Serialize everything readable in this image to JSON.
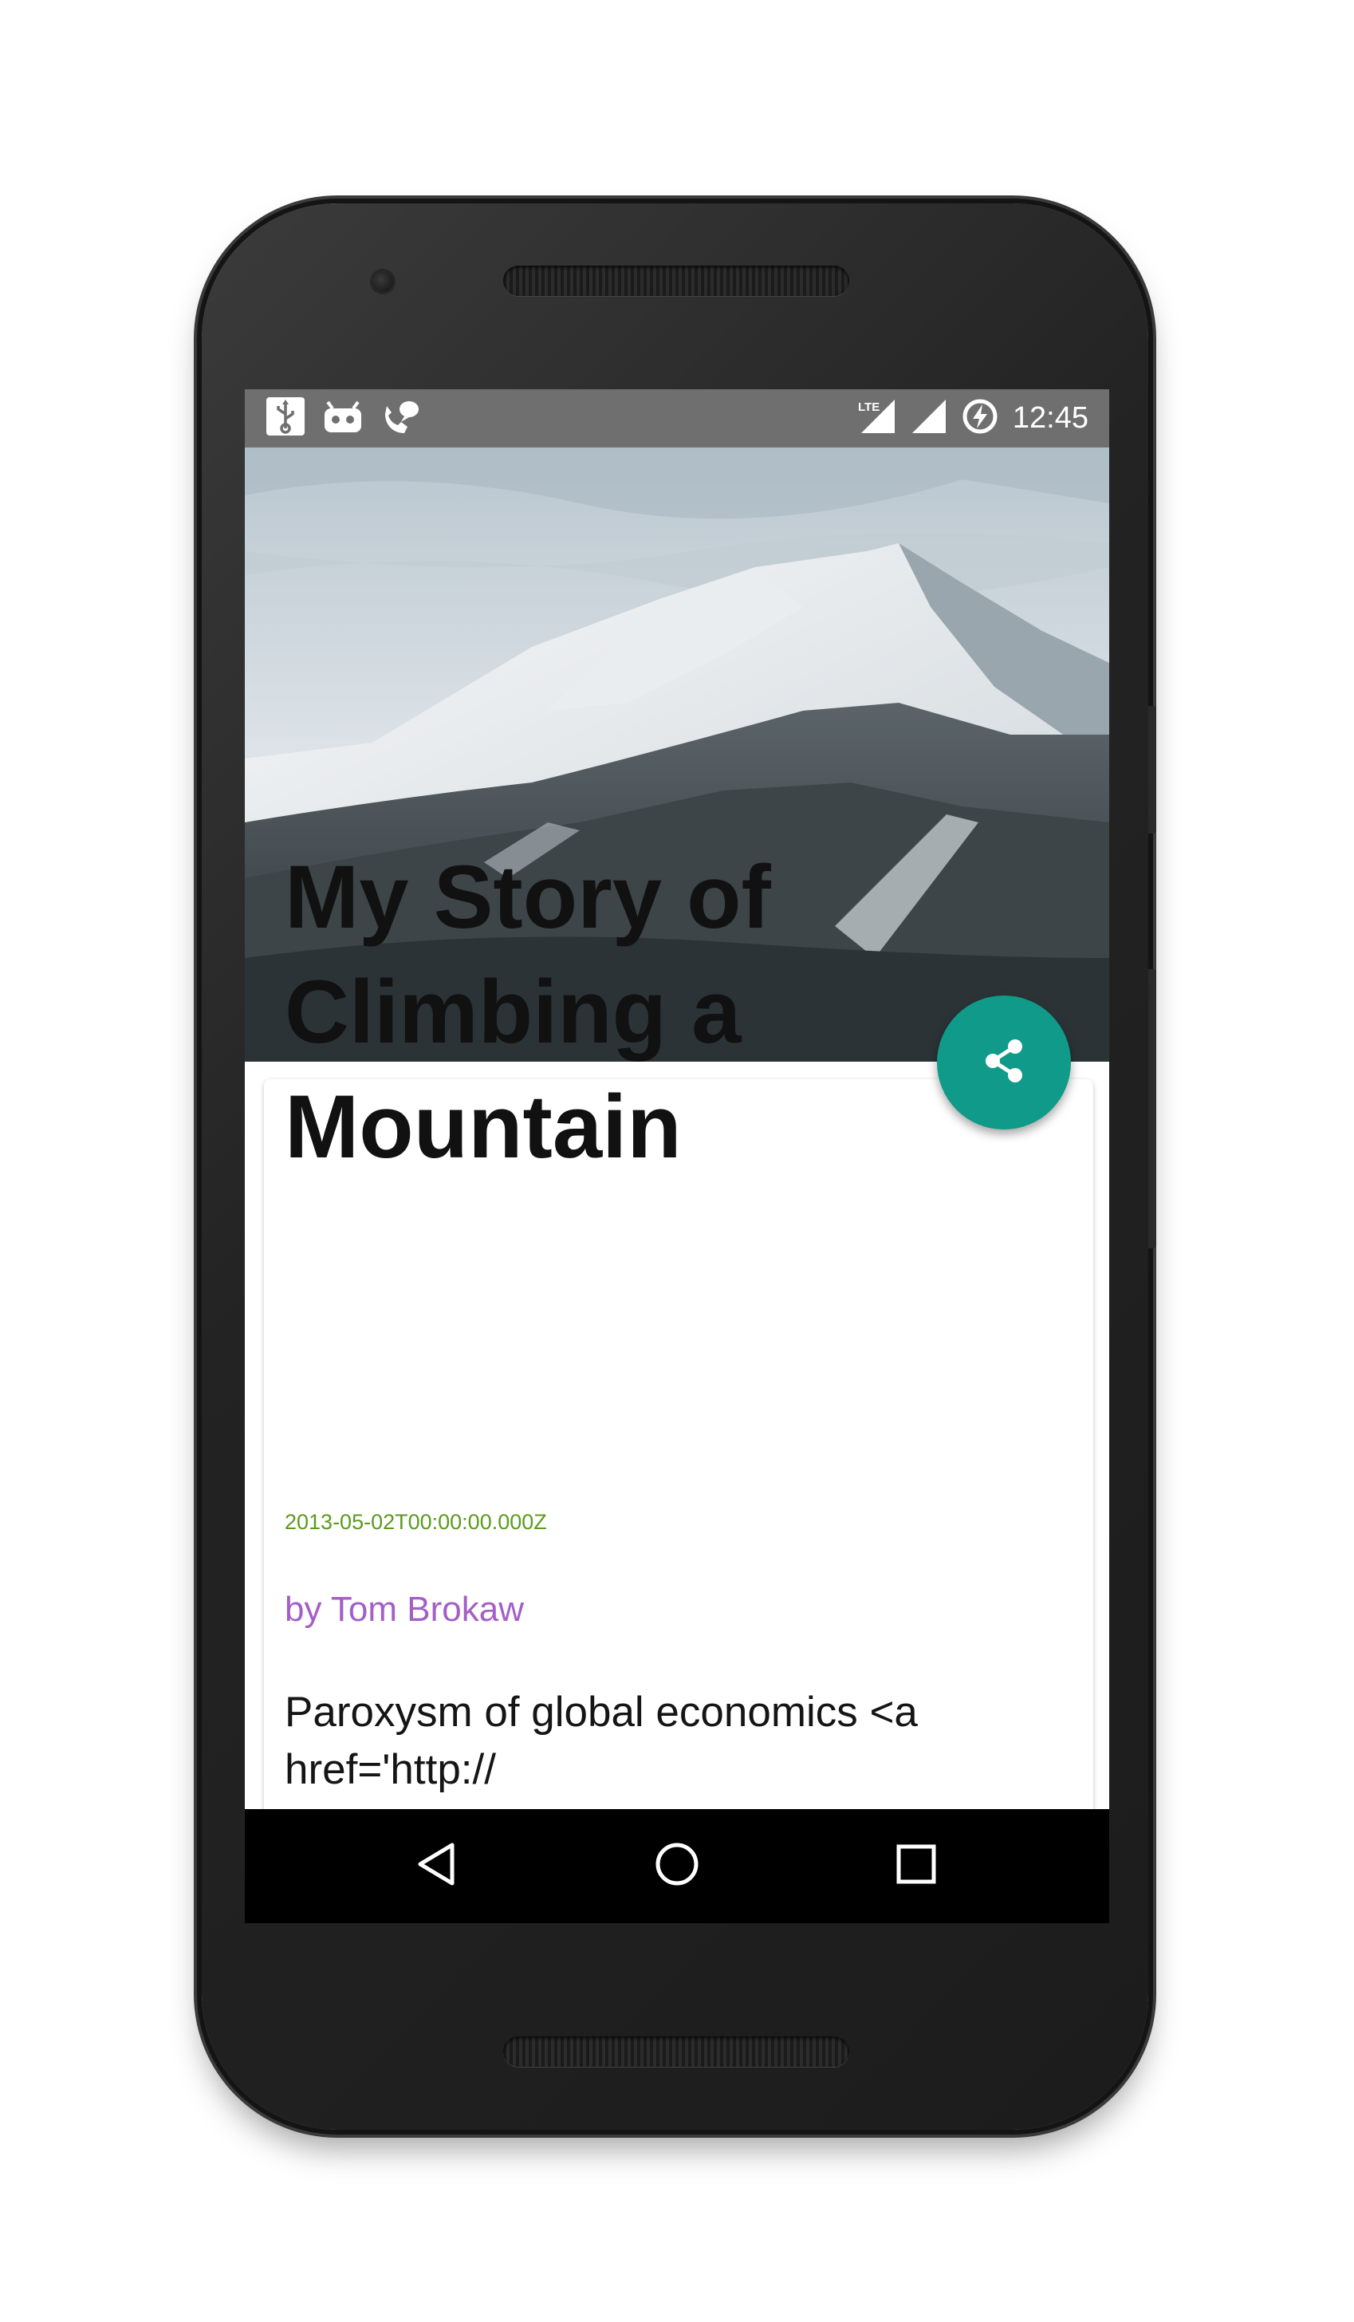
{
  "status_bar": {
    "time": "12:45",
    "left_icons": [
      "usb-icon",
      "android-debug-icon",
      "phone-call-icon"
    ],
    "right_icons": [
      "lte-signal-icon",
      "cell-signal-icon",
      "battery-charging-icon"
    ]
  },
  "article": {
    "title": "My Story of Climbing a Mountain",
    "date": "2013-05-02T00:00:00.000Z",
    "author": "by Tom Brokaw",
    "body": "Paroxysm of global economics <a href='http://"
  },
  "fab": {
    "icon": "share-icon",
    "color": "#109a89"
  },
  "nav_bar": {
    "icons": [
      "back-icon",
      "home-icon",
      "recents-icon"
    ]
  },
  "colors": {
    "accent": "#109a89",
    "date": "#5c9a1e",
    "author": "#a45ec8",
    "status_bar": "#6f6f6f"
  }
}
